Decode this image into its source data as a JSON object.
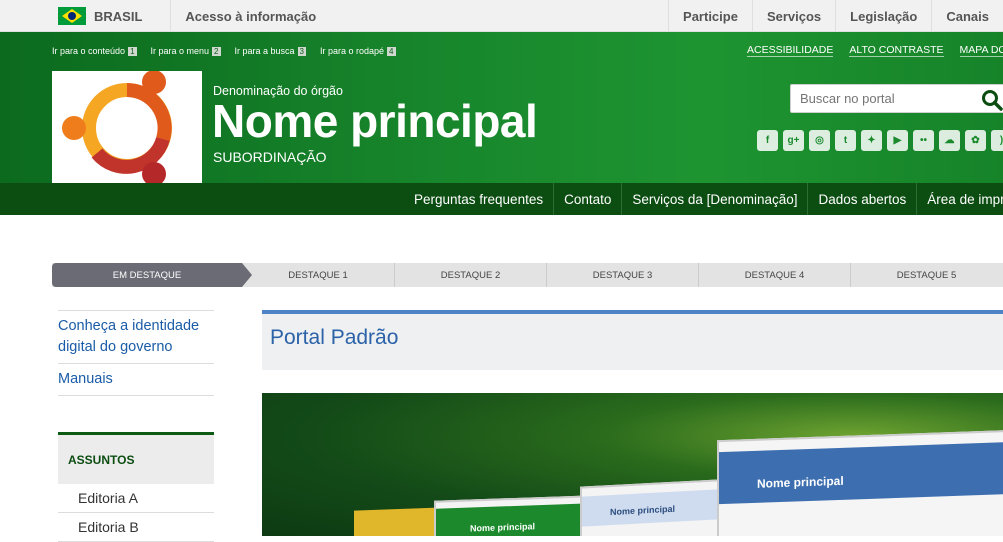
{
  "govbar": {
    "country": "BRASIL",
    "access_info": "Acesso à informação",
    "links": [
      "Participe",
      "Serviços",
      "Legislação",
      "Canais"
    ]
  },
  "accessbar": {
    "items": [
      {
        "label": "Ir para o conteúdo",
        "key": "1"
      },
      {
        "label": "Ir para o menu",
        "key": "2"
      },
      {
        "label": "Ir para a busca",
        "key": "3"
      },
      {
        "label": "Ir para o rodapé",
        "key": "4"
      }
    ],
    "top_links": [
      "ACESSIBILIDADE",
      "ALTO CONTRASTE",
      "MAPA DO SITE"
    ]
  },
  "header": {
    "org_denomination": "Denominação do órgão",
    "name": "Nome principal",
    "subordination": "SUBORDINAÇÃO"
  },
  "search": {
    "placeholder": "Buscar no portal"
  },
  "social": [
    {
      "icon": "facebook-icon",
      "glyph": "f"
    },
    {
      "icon": "google-plus-icon",
      "glyph": "g+"
    },
    {
      "icon": "instagram-icon",
      "glyph": "◎"
    },
    {
      "icon": "tumblr-icon",
      "glyph": "t"
    },
    {
      "icon": "twitter-icon",
      "glyph": "✦"
    },
    {
      "icon": "youtube-icon",
      "glyph": "▶"
    },
    {
      "icon": "flickr-icon",
      "glyph": "••"
    },
    {
      "icon": "soundcloud-icon",
      "glyph": "☁"
    },
    {
      "icon": "slideshare-icon",
      "glyph": "✿"
    },
    {
      "icon": "rss-icon",
      "glyph": ")"
    }
  ],
  "nav": {
    "items": [
      "Perguntas frequentes",
      "Contato",
      "Serviços da [Denominação]",
      "Dados abertos",
      "Área de imprensa"
    ]
  },
  "tabs": [
    "EM DESTAQUE",
    "DESTAQUE 1",
    "DESTAQUE 2",
    "DESTAQUE 3",
    "DESTAQUE 4",
    "DESTAQUE 5"
  ],
  "sidebar": {
    "links": [
      "Conheça a identidade digital do governo",
      "Manuais"
    ],
    "section_title": "ASSUNTOS",
    "sub_items": [
      "Editoria A",
      "Editoria B"
    ]
  },
  "main": {
    "title": "Portal Padrão",
    "hero_mock_title": "Nome principal"
  },
  "colors": {
    "header_green": "#18872c",
    "nav_dark_green": "#0c4d12",
    "link_blue": "#1a5ca7",
    "tab_active": "#6b6b75"
  }
}
